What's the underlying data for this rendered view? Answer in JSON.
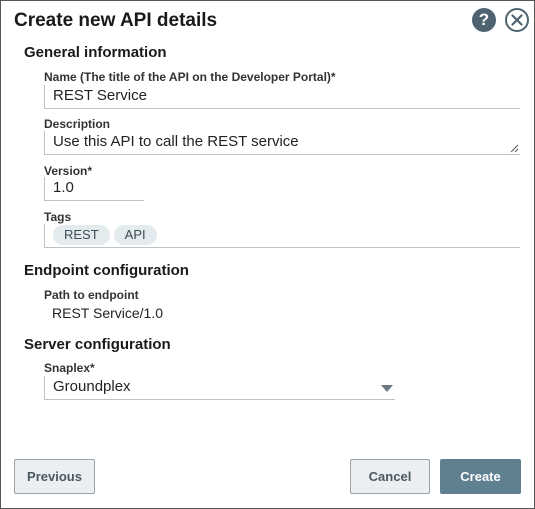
{
  "dialog": {
    "title": "Create new API details"
  },
  "icons": {
    "help": "?",
    "close": "close-icon"
  },
  "general": {
    "heading": "General information",
    "name_label": "Name (The title of the API on the Developer Portal)*",
    "name_value": "REST Service",
    "description_label": "Description",
    "description_value": "Use this API to call the REST service",
    "version_label": "Version*",
    "version_value": "1.0",
    "tags_label": "Tags",
    "tags": [
      "REST",
      "API"
    ]
  },
  "endpoint": {
    "heading": "Endpoint configuration",
    "path_label": "Path to endpoint",
    "path_value": "REST Service/1.0"
  },
  "server": {
    "heading": "Server configuration",
    "snaplex_label": "Snaplex*",
    "snaplex_value": "Groundplex"
  },
  "buttons": {
    "previous": "Previous",
    "cancel": "Cancel",
    "create": "Create"
  }
}
